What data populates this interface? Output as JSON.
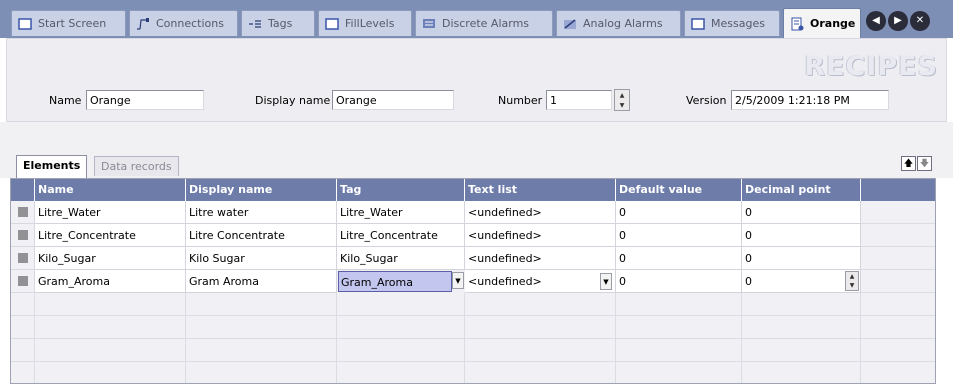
{
  "tabs": [
    {
      "label": "Start Screen",
      "icon": "screen-icon"
    },
    {
      "label": "Connections",
      "icon": "connections-icon"
    },
    {
      "label": "Tags",
      "icon": "tags-icon"
    },
    {
      "label": "FillLevels",
      "icon": "screen-icon"
    },
    {
      "label": "Discrete Alarms",
      "icon": "discrete-alarms-icon"
    },
    {
      "label": "Analog Alarms",
      "icon": "analog-alarms-icon"
    },
    {
      "label": "Messages",
      "icon": "screen-icon"
    },
    {
      "label": "Orange",
      "icon": "recipe-icon",
      "active": true
    }
  ],
  "header": {
    "title": "RECIPES",
    "name_label": "Name",
    "name_value": "Orange",
    "display_name_label": "Display name",
    "display_name_value": "Orange",
    "number_label": "Number",
    "number_value": "1",
    "version_label": "Version",
    "version_value": "2/5/2009 1:21:18 PM"
  },
  "subtabs": {
    "elements": "Elements",
    "data_records": "Data records"
  },
  "grid": {
    "columns": [
      "Name",
      "Display name",
      "Tag",
      "Text list",
      "Default value",
      "Decimal point"
    ],
    "rows": [
      [
        "Litre_Water",
        "Litre water",
        "Litre_Water",
        "<undefined>",
        "0",
        "0"
      ],
      [
        "Litre_Concentrate",
        "Litre Concentrate",
        "Litre_Concentrate",
        "<undefined>",
        "0",
        "0"
      ],
      [
        "Kilo_Sugar",
        "Kilo Sugar",
        "Kilo_Sugar",
        "<undefined>",
        "0",
        "0"
      ],
      [
        "Gram_Aroma",
        "Gram Aroma",
        "Gram_Aroma",
        "<undefined>",
        "0",
        "0"
      ]
    ]
  },
  "colors": {
    "tabstrip": "#7e8fb6",
    "grid_header": "#6d7ca9",
    "selection": "#c3c6ef"
  }
}
